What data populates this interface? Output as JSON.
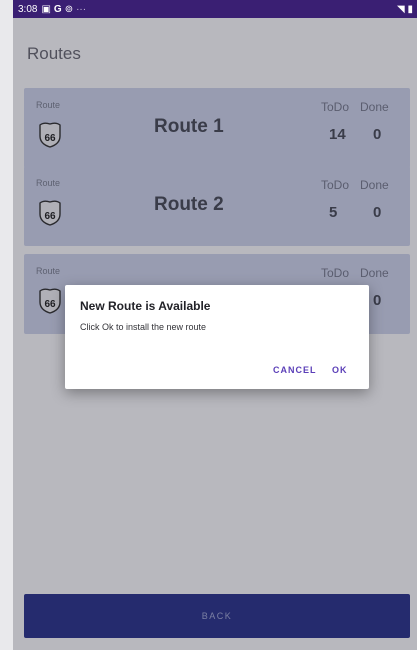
{
  "status_bar": {
    "time": "3:08",
    "icons": [
      "notification-icon",
      "google-icon",
      "settings-icon",
      "more-icon"
    ],
    "right_icons": [
      "wifi-icon",
      "battery-icon"
    ]
  },
  "screen": {
    "title": "Routes"
  },
  "routes": [
    {
      "label": "Route",
      "name": "Route 1",
      "todo_label": "ToDo",
      "done_label": "Done",
      "todo": "14",
      "done": "0"
    },
    {
      "label": "Route",
      "name": "Route 2",
      "todo_label": "ToDo",
      "done_label": "Done",
      "todo": "5",
      "done": "0"
    },
    {
      "label": "Route",
      "name": "",
      "todo_label": "ToDo",
      "done_label": "Done",
      "todo": "",
      "done": "0"
    }
  ],
  "dialog": {
    "title": "New Route is Available",
    "message": "Click Ok to install the new route",
    "cancel_label": "CANCEL",
    "ok_label": "OK"
  },
  "footer": {
    "back_label": "BACK"
  },
  "colors": {
    "status_bar": "#3a1f73",
    "card": "#c4cbe4",
    "primary": "#1b2480",
    "accent": "#5b3fb8"
  }
}
